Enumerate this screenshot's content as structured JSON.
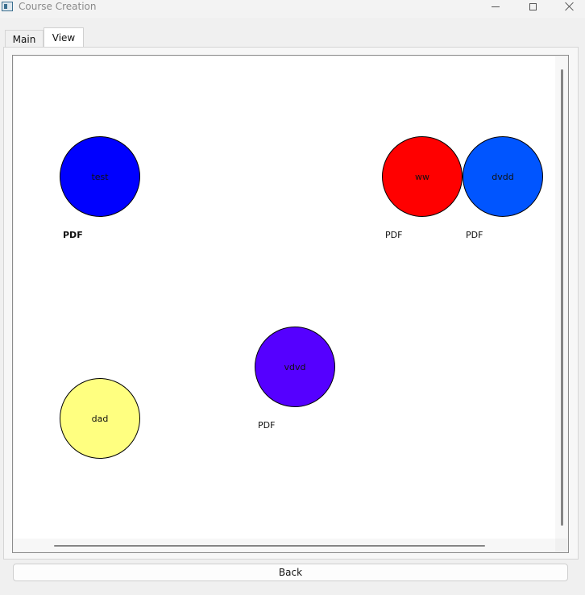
{
  "window": {
    "title": "Course Creation"
  },
  "tabs": [
    {
      "label": "Main",
      "selected": false
    },
    {
      "label": "View",
      "selected": true
    }
  ],
  "graph": {
    "nodes": [
      {
        "label": "test",
        "color": "#0000ff",
        "file_label": "PDF",
        "file_label_bold": true
      },
      {
        "label": "ww",
        "color": "#ff0000",
        "file_label": "PDF",
        "file_label_bold": false
      },
      {
        "label": "dvdd",
        "color": "#0055ff",
        "file_label": "PDF",
        "file_label_bold": false
      },
      {
        "label": "vdvd",
        "color": "#5500ff",
        "file_label": "PDF",
        "file_label_bold": false
      },
      {
        "label": "dad",
        "color": "#ffff80",
        "file_label": "",
        "file_label_bold": false
      }
    ],
    "edges": [
      {
        "from": "ww",
        "to": "dvdd"
      }
    ]
  },
  "footer": {
    "back_label": "Back"
  }
}
